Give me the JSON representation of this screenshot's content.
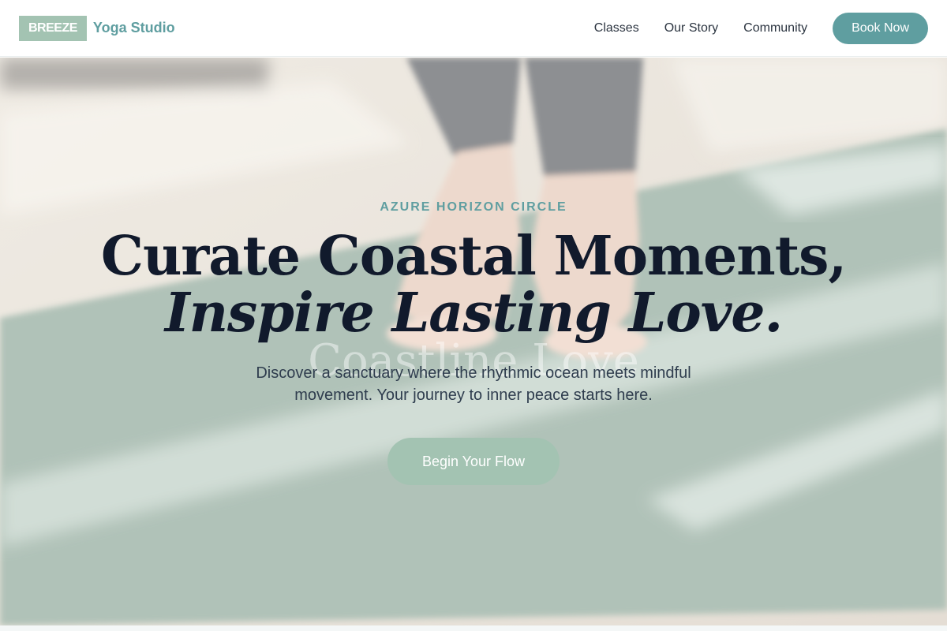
{
  "brand": {
    "badge": "BREEZE",
    "name": "Yoga Studio"
  },
  "nav": {
    "links": [
      "Classes",
      "Our Story",
      "Community"
    ],
    "cta": "Book Now"
  },
  "hero": {
    "eyebrow": "AZURE HORIZON CIRCLE",
    "headline_line1": "Curate Coastal Moments,",
    "headline_line2": "Inspire Lasting Love.",
    "ghost_text": "Coastline Love",
    "subtitle": "Discover a sanctuary where the rhythmic ocean meets mindful movement. Your journey to inner peace starts here.",
    "cta": "Begin Your Flow"
  },
  "colors": {
    "accent": "#5f9ea0",
    "sage": "#a3c3b2",
    "heading": "#111a2c"
  }
}
